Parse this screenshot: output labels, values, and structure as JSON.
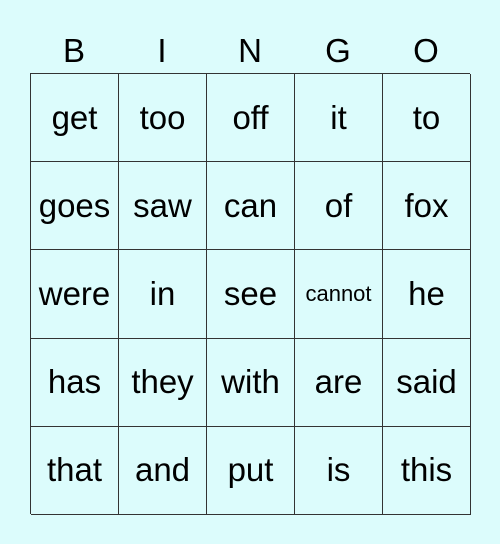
{
  "header": [
    "B",
    "I",
    "N",
    "G",
    "O"
  ],
  "rows": [
    [
      "get",
      "too",
      "off",
      "it",
      "to"
    ],
    [
      "goes",
      "saw",
      "can",
      "of",
      "fox"
    ],
    [
      "were",
      "in",
      "see",
      "cannot",
      "he"
    ],
    [
      "has",
      "they",
      "with",
      "are",
      "said"
    ],
    [
      "that",
      "and",
      "put",
      "is",
      "this"
    ]
  ]
}
